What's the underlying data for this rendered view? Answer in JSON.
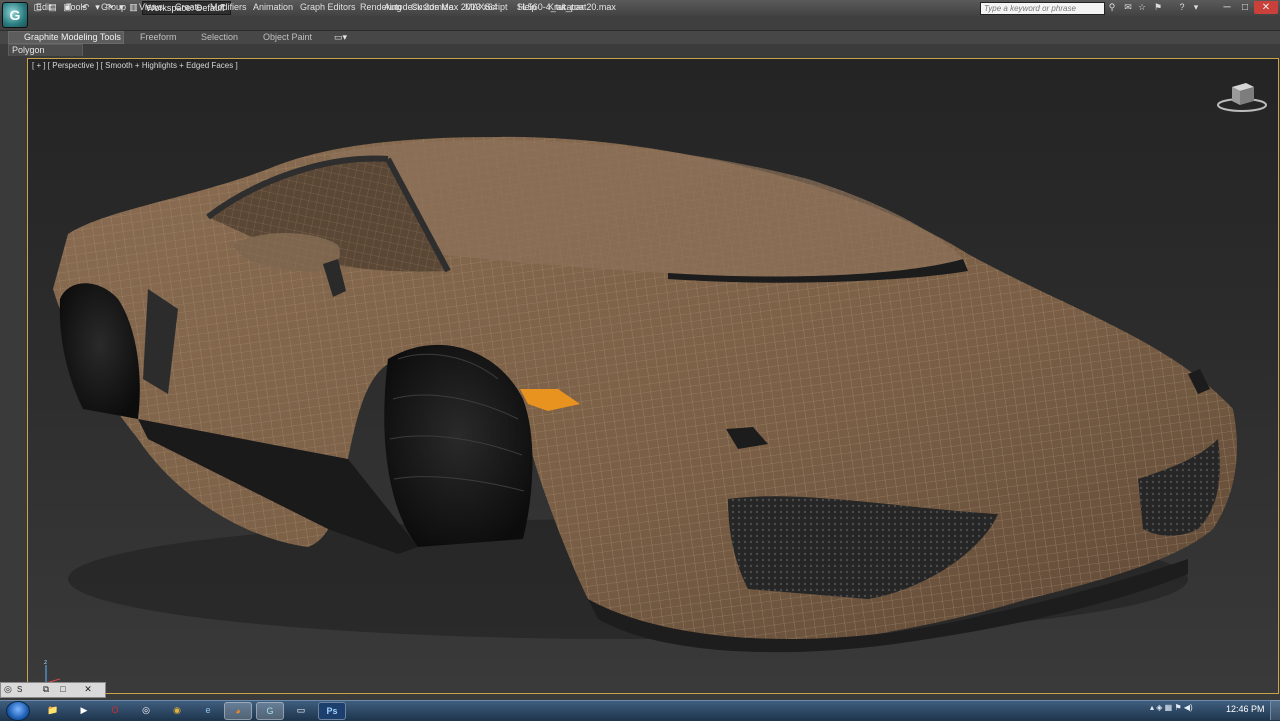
{
  "titlebar": {
    "workspace_label": "Workspace: Default",
    "app_title": "Autodesk 3ds Max  2013 x64",
    "file_name": "SL560-4_tut_part20.max",
    "search_placeholder": "Type a keyword or phrase",
    "logo_glyph": "G"
  },
  "menu": [
    "Edit",
    "Tools",
    "Group",
    "Views",
    "Create",
    "Modifiers",
    "Animation",
    "Graph Editors",
    "Rendering",
    "Customize",
    "MAXScript",
    "Help",
    "Krakatoa"
  ],
  "ribbon": {
    "tabs": [
      "Graphite Modeling Tools",
      "Freeform",
      "Selection",
      "Object Paint"
    ],
    "panel_label": "Polygon Modeling"
  },
  "viewport": {
    "label": "[ + ] [ Perspective ] [ Smooth + Highlights + Edged Faces ]"
  },
  "mini_panel": {
    "label": "S"
  },
  "taskbar": {
    "apps": [
      {
        "name": "explorer",
        "glyph": "📁",
        "color": "#e3b54a"
      },
      {
        "name": "media-player",
        "glyph": "▶",
        "color": "#f08a24"
      },
      {
        "name": "opera",
        "glyph": "O",
        "color": "#d22b2b"
      },
      {
        "name": "network",
        "glyph": "◎",
        "color": "#6aa4d8"
      },
      {
        "name": "chrome",
        "glyph": "◉",
        "color": "#e2b33b"
      },
      {
        "name": "ie",
        "glyph": "e",
        "color": "#3d8fd6"
      },
      {
        "name": "firefox",
        "glyph": "◕",
        "color": "#e06d1f"
      },
      {
        "name": "3dsmax",
        "glyph": "G",
        "color": "#4fb0b4"
      },
      {
        "name": "window",
        "glyph": "▭",
        "color": "#9cb7d3"
      },
      {
        "name": "photoshop",
        "glyph": "Ps",
        "color": "#1d3f6e"
      }
    ],
    "clock": "12:46 PM"
  },
  "colors": {
    "mesh": "#7a6048",
    "wire": "#a78e72",
    "turn_signal": "#e8921f",
    "viewport_border": "#c9a34a"
  }
}
